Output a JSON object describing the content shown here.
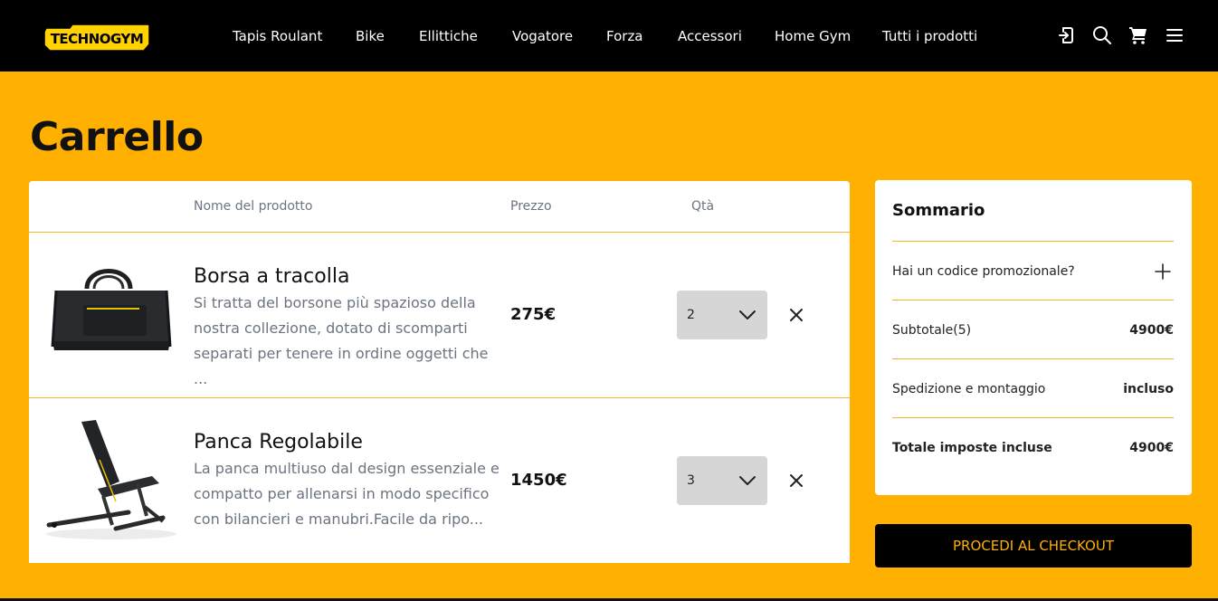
{
  "brand": {
    "logo_text": "TECHNOGYM",
    "accent_color": "#ffb000"
  },
  "nav": {
    "items": [
      {
        "label": "Tapis Roulant"
      },
      {
        "label": "Bike"
      },
      {
        "label": "Ellittiche"
      },
      {
        "label": "Vogatore"
      },
      {
        "label": "Forza"
      },
      {
        "label": "Accessori"
      },
      {
        "label": "Home Gym"
      },
      {
        "label": "Tutti i prodotti"
      }
    ],
    "icons": [
      "login-icon",
      "search-icon",
      "cart-icon",
      "menu-icon"
    ]
  },
  "page": {
    "title": "Carrello"
  },
  "cart": {
    "headers": {
      "name": "Nome del prodotto",
      "price": "Prezzo",
      "qty": "Qtà"
    },
    "items": [
      {
        "name": "Borsa a tracolla",
        "description": "Si tratta del borsone più spazioso della nostra collezione, dotato di scomparti separati per tenere in ordine oggetti che ...",
        "price": "275€",
        "qty": "2"
      },
      {
        "name": "Panca Regolabile",
        "description": "La panca multiuso dal design essenziale e compatto per allenarsi in modo specifico con bilancieri e manubri.Facile da ripo...",
        "price": "1450€",
        "qty": "3"
      }
    ]
  },
  "summary": {
    "title": "Sommario",
    "promo_label": "Hai un codice promozionale?",
    "subtotal_label": "Subtotale(5)",
    "subtotal_value": "4900€",
    "shipping_label": "Spedizione e montaggio",
    "shipping_value": "incluso",
    "total_label": "Totale imposte incluse",
    "total_value": "4900€"
  },
  "checkout": {
    "label": "PROCEDI AL CHECKOUT"
  }
}
